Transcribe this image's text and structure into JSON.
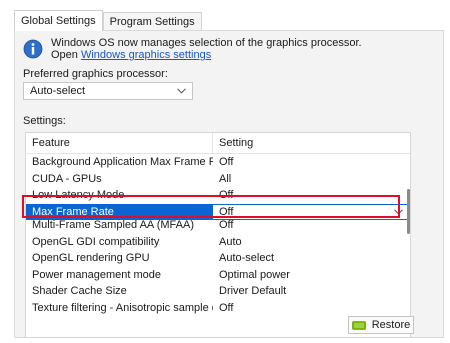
{
  "tabs": [
    {
      "label": "Global Settings",
      "active": true
    },
    {
      "label": "Program Settings",
      "active": false
    }
  ],
  "info": {
    "line1": "Windows OS now manages selection of the graphics processor.",
    "line2_prefix": "Open ",
    "link": "Windows graphics settings",
    "icon": "info-icon"
  },
  "preferred": {
    "label": "Preferred graphics processor:",
    "value": "Auto-select"
  },
  "settings": {
    "label": "Settings:",
    "headers": {
      "feature": "Feature",
      "setting": "Setting"
    },
    "rows": [
      {
        "feature": "Background Application Max Frame Rate",
        "setting": "Off"
      },
      {
        "feature": "CUDA - GPUs",
        "setting": "All"
      },
      {
        "feature": "Low Latency Mode",
        "setting": "Off"
      },
      {
        "feature": "Max Frame Rate",
        "setting": "Off",
        "selected": true
      },
      {
        "feature": "Multi-Frame Sampled AA (MFAA)",
        "setting": "Off"
      },
      {
        "feature": "OpenGL GDI compatibility",
        "setting": "Auto"
      },
      {
        "feature": "OpenGL rendering GPU",
        "setting": "Auto-select"
      },
      {
        "feature": "Power management mode",
        "setting": "Optimal power"
      },
      {
        "feature": "Shader Cache Size",
        "setting": "Driver Default"
      },
      {
        "feature": "Texture filtering - Anisotropic sample opti...",
        "setting": "Off"
      }
    ]
  },
  "restore_label": "Restore",
  "colors": {
    "selection": "#0a64d2",
    "highlight_border": "#e00d2a",
    "link": "#1a55c5",
    "nvidia_green": "#76b900"
  }
}
